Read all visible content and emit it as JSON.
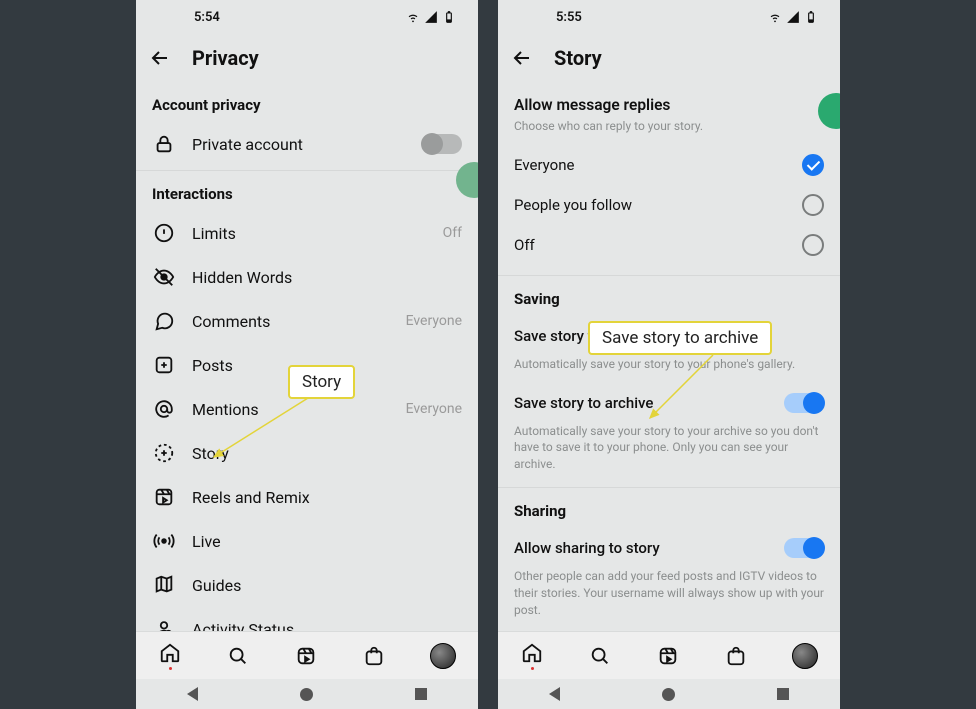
{
  "phoneLeft": {
    "time": "5:54",
    "headerTitle": "Privacy",
    "sections": {
      "accountPrivacy": {
        "label": "Account privacy",
        "privateAccount": "Private account"
      },
      "interactions": {
        "label": "Interactions",
        "limits": {
          "label": "Limits",
          "value": "Off"
        },
        "hiddenWords": "Hidden Words",
        "comments": {
          "label": "Comments",
          "value": "Everyone"
        },
        "posts": "Posts",
        "mentions": {
          "label": "Mentions",
          "value": "Everyone"
        },
        "story": "Story",
        "reels": "Reels and Remix",
        "live": "Live",
        "guides": "Guides",
        "activity": "Activity Status"
      }
    },
    "callout": "Story"
  },
  "phoneRight": {
    "time": "5:55",
    "headerTitle": "Story",
    "allowReplies": {
      "title": "Allow message replies",
      "sub": "Choose who can reply to your story.",
      "opt1": "Everyone",
      "opt2": "People you follow",
      "opt3": "Off"
    },
    "saving": {
      "label": "Saving",
      "gallery": {
        "title": "Save story to gallery",
        "sub": "Automatically save your story to your phone's gallery."
      },
      "archive": {
        "title": "Save story to archive",
        "sub": "Automatically save your story to your archive so you don't have to save it to your phone. Only you can see your archive."
      }
    },
    "sharing": {
      "label": "Sharing",
      "allow": {
        "title": "Allow sharing to story",
        "sub": "Other people can add your feed posts and IGTV videos to their stories. Your username will always show up with your post."
      }
    },
    "callout": "Save story to archive"
  }
}
